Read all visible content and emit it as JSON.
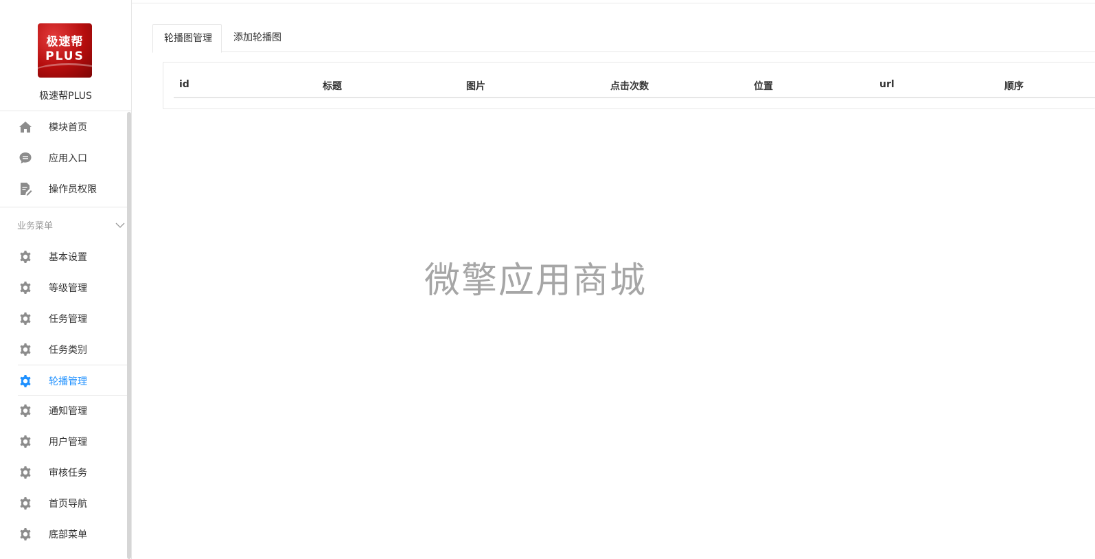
{
  "brand": {
    "logo_line1": "极速帮",
    "logo_line2": "PLUS",
    "name": "极速帮PLUS"
  },
  "sidebar": {
    "top_items": [
      {
        "label": "模块首页",
        "icon": "home-icon"
      },
      {
        "label": "应用入口",
        "icon": "chat-bubble-icon"
      },
      {
        "label": "操作员权限",
        "icon": "document-edit-icon"
      }
    ],
    "section_title": "业务菜单",
    "section_items": [
      {
        "label": "基本设置",
        "icon": "gear-icon"
      },
      {
        "label": "等级管理",
        "icon": "gear-icon"
      },
      {
        "label": "任务管理",
        "icon": "gear-icon"
      },
      {
        "label": "任务类别",
        "icon": "gear-icon"
      },
      {
        "label": "轮播管理",
        "icon": "gear-icon",
        "active": true
      },
      {
        "label": "通知管理",
        "icon": "gear-icon"
      },
      {
        "label": "用户管理",
        "icon": "gear-icon"
      },
      {
        "label": "审核任务",
        "icon": "gear-icon"
      },
      {
        "label": "首页导航",
        "icon": "gear-icon"
      },
      {
        "label": "底部菜单",
        "icon": "gear-icon"
      }
    ]
  },
  "tabs": [
    {
      "label": "轮播图管理",
      "active": true
    },
    {
      "label": "添加轮播图",
      "active": false
    }
  ],
  "table": {
    "columns": [
      "id",
      "标题",
      "图片",
      "点击次数",
      "位置",
      "url",
      "顺序"
    ],
    "rows": []
  },
  "watermark": "微擎应用商城",
  "colors": {
    "accent": "#1e90ff",
    "icon_gray": "#8c8c8c",
    "logo_red": "#c41414"
  }
}
